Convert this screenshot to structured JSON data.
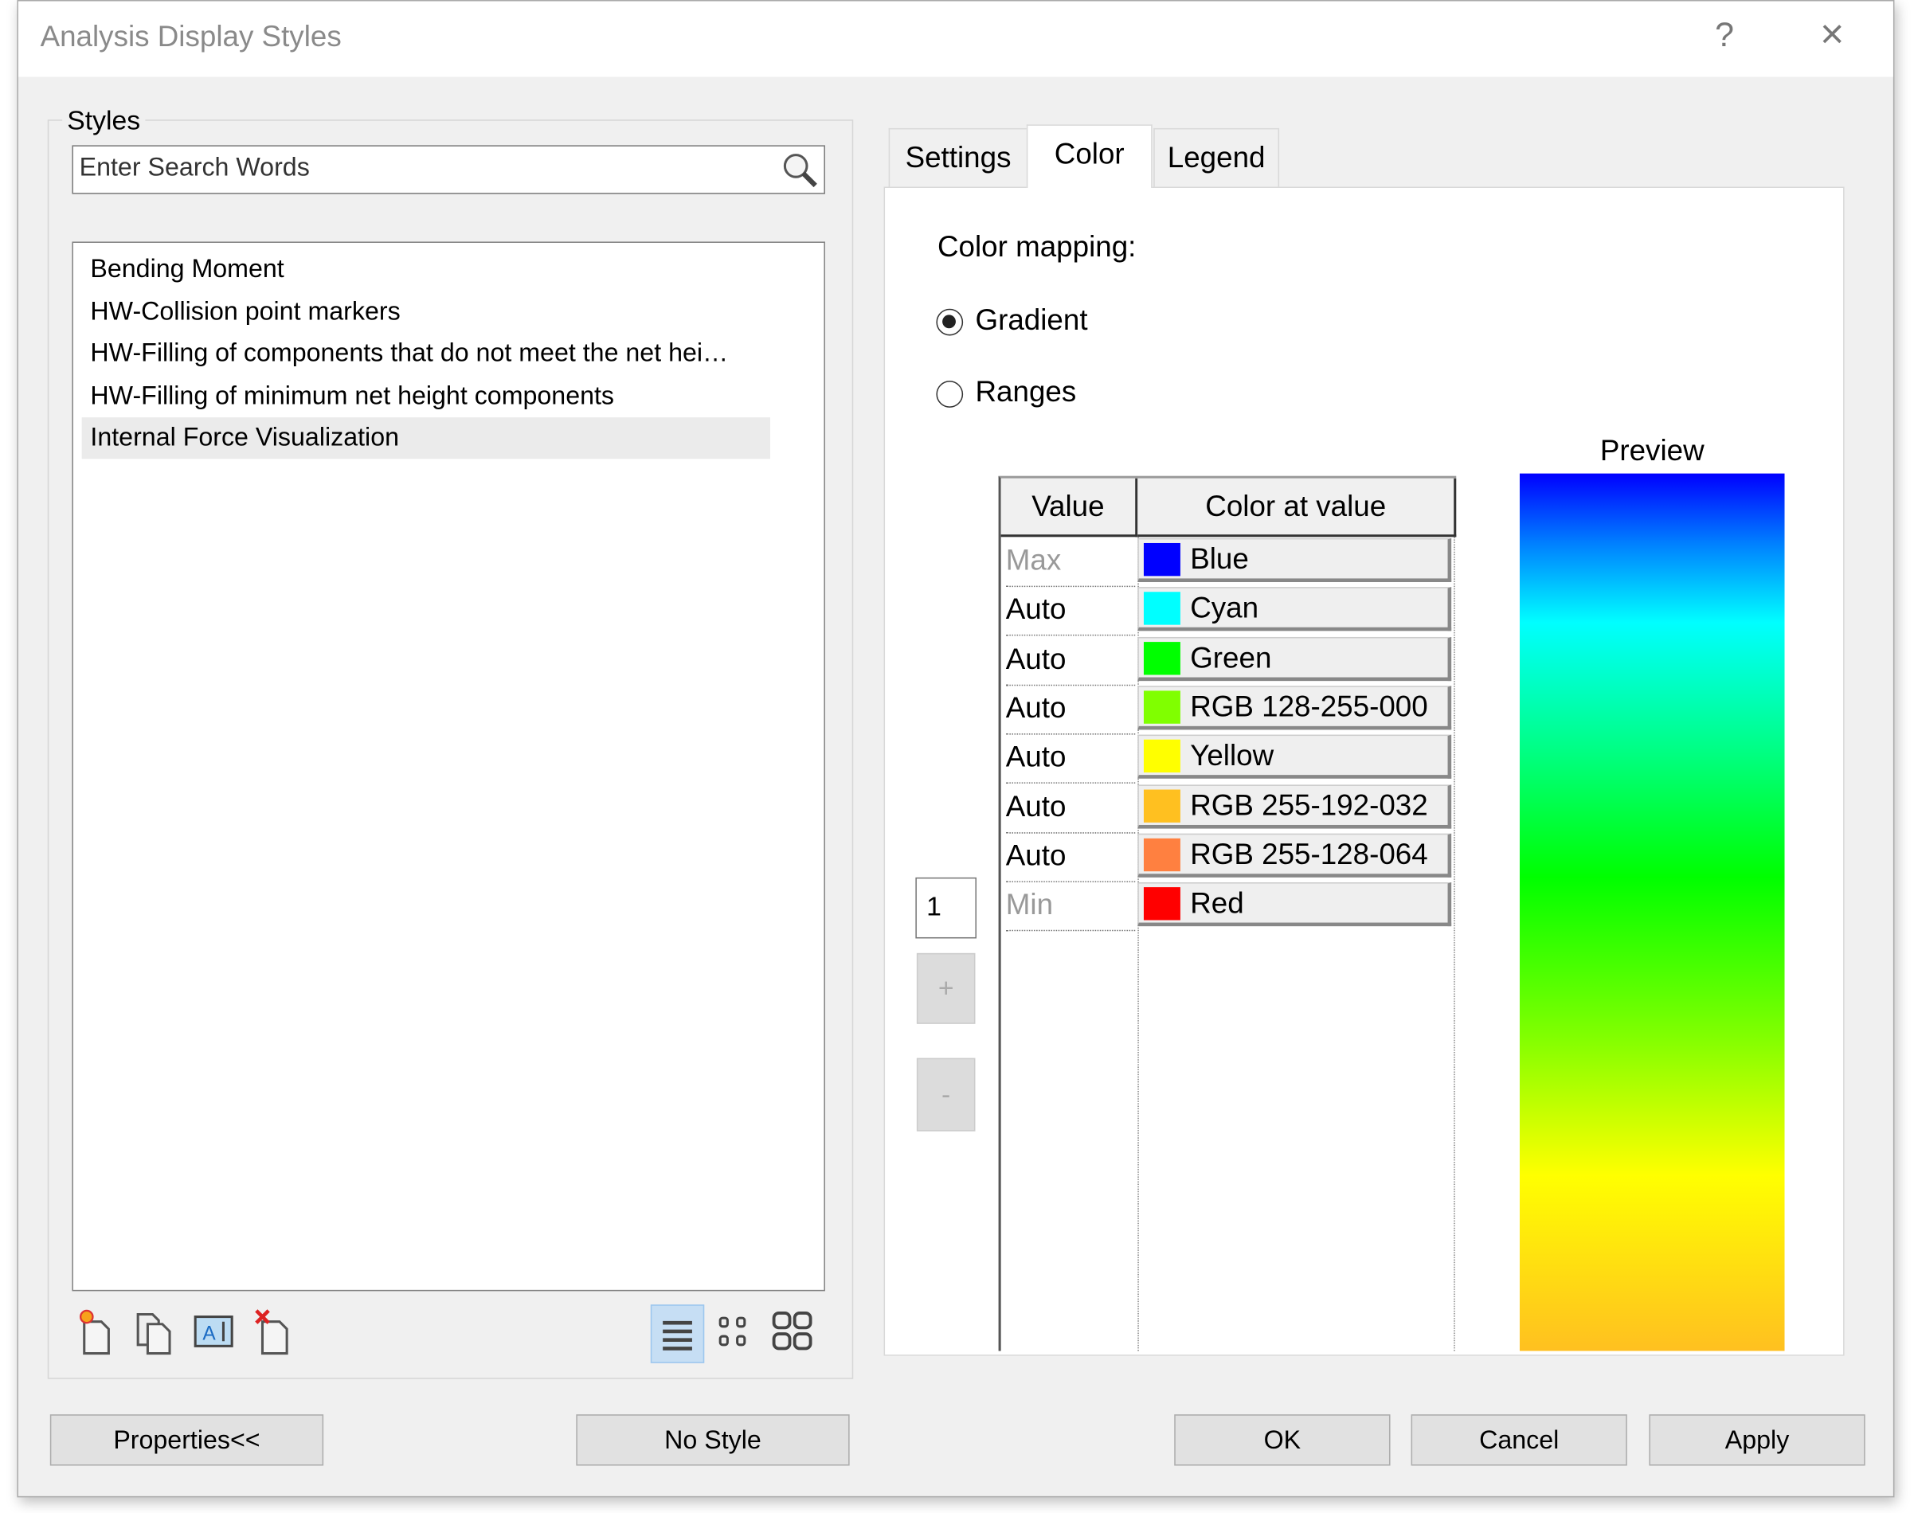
{
  "window": {
    "title": "Analysis Display Styles",
    "help_label": "?",
    "close_label": "×"
  },
  "styles": {
    "group_label": "Styles",
    "search_placeholder": "Enter Search Words",
    "items": [
      {
        "label": "Bending Moment",
        "selected": false
      },
      {
        "label": "HW-Collision point markers",
        "selected": false
      },
      {
        "label": "HW-Filling of components that do not meet the net hei…",
        "selected": false
      },
      {
        "label": "HW-Filling of minimum net height components",
        "selected": false
      },
      {
        "label": "Internal Force Visualization",
        "selected": true
      }
    ],
    "toolbar": [
      "new-style-icon",
      "duplicate-style-icon",
      "rename-style-icon",
      "delete-style-icon"
    ],
    "view_modes": [
      "list-view-icon",
      "small-icons-view-icon",
      "large-icons-view-icon"
    ]
  },
  "tabs": [
    {
      "label": "Settings",
      "active": false
    },
    {
      "label": "Color",
      "active": true
    },
    {
      "label": "Legend",
      "active": false
    }
  ],
  "color": {
    "mapping_label": "Color mapping:",
    "options": [
      {
        "label": "Gradient",
        "checked": true
      },
      {
        "label": "Ranges",
        "checked": false
      }
    ],
    "preview_label": "Preview",
    "table_headers": [
      "Value",
      "Color at value"
    ],
    "rows": [
      {
        "value": "Max",
        "color_name": "Blue",
        "hex": "#0000ff",
        "dim": true
      },
      {
        "value": "Auto",
        "color_name": "Cyan",
        "hex": "#00ffff",
        "dim": false
      },
      {
        "value": "Auto",
        "color_name": "Green",
        "hex": "#00ff00",
        "dim": false
      },
      {
        "value": "Auto",
        "color_name": "RGB 128-255-000",
        "hex": "#80ff00",
        "dim": false
      },
      {
        "value": "Auto",
        "color_name": "Yellow",
        "hex": "#ffff00",
        "dim": false
      },
      {
        "value": "Auto",
        "color_name": "RGB 255-192-032",
        "hex": "#ffc020",
        "dim": false
      },
      {
        "value": "Auto",
        "color_name": "RGB 255-128-064",
        "hex": "#ff8040",
        "dim": false
      },
      {
        "value": "Min",
        "color_name": "Red",
        "hex": "#ff0000",
        "dim": true
      }
    ],
    "count_value": "1",
    "add_label": "+",
    "remove_label": "-"
  },
  "buttons": {
    "properties": "Properties<<",
    "no_style": "No Style",
    "ok": "OK",
    "cancel": "Cancel",
    "apply": "Apply"
  }
}
